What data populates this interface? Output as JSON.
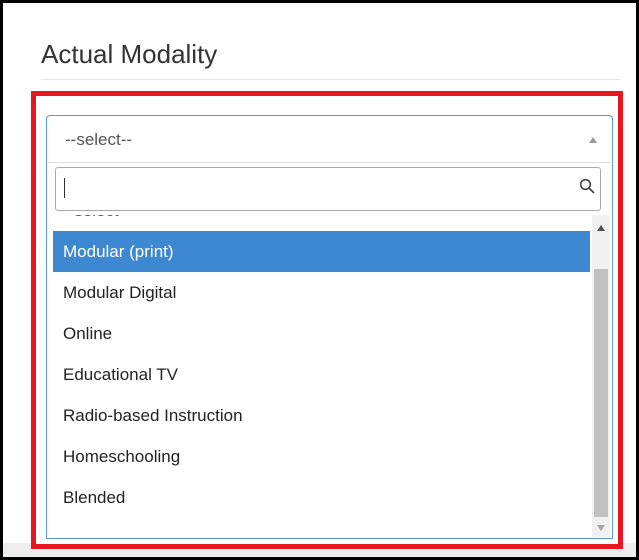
{
  "form": {
    "title": "Actual Modality"
  },
  "select": {
    "value": "--select--",
    "search_value": ""
  },
  "dropdown": {
    "options": [
      {
        "label": "--select--",
        "selected": false,
        "partially_visible": true
      },
      {
        "label": "Modular (print)",
        "selected": true
      },
      {
        "label": "Modular Digital",
        "selected": false
      },
      {
        "label": "Online",
        "selected": false
      },
      {
        "label": "Educational TV",
        "selected": false
      },
      {
        "label": "Radio-based Instruction",
        "selected": false
      },
      {
        "label": "Homeschooling",
        "selected": false
      },
      {
        "label": "Blended",
        "selected": false
      }
    ],
    "scroll_position": 0.05
  },
  "icons": {
    "search": "search-icon",
    "select_arrow": "chevron-up-icon",
    "scroll_up": "scroll-up-arrow-icon",
    "scroll_down": "scroll-down-arrow-icon"
  },
  "colors": {
    "highlight_border": "#e8161f",
    "selected_option_bg": "#3e88d2",
    "focus_border": "#5b9bd5"
  }
}
